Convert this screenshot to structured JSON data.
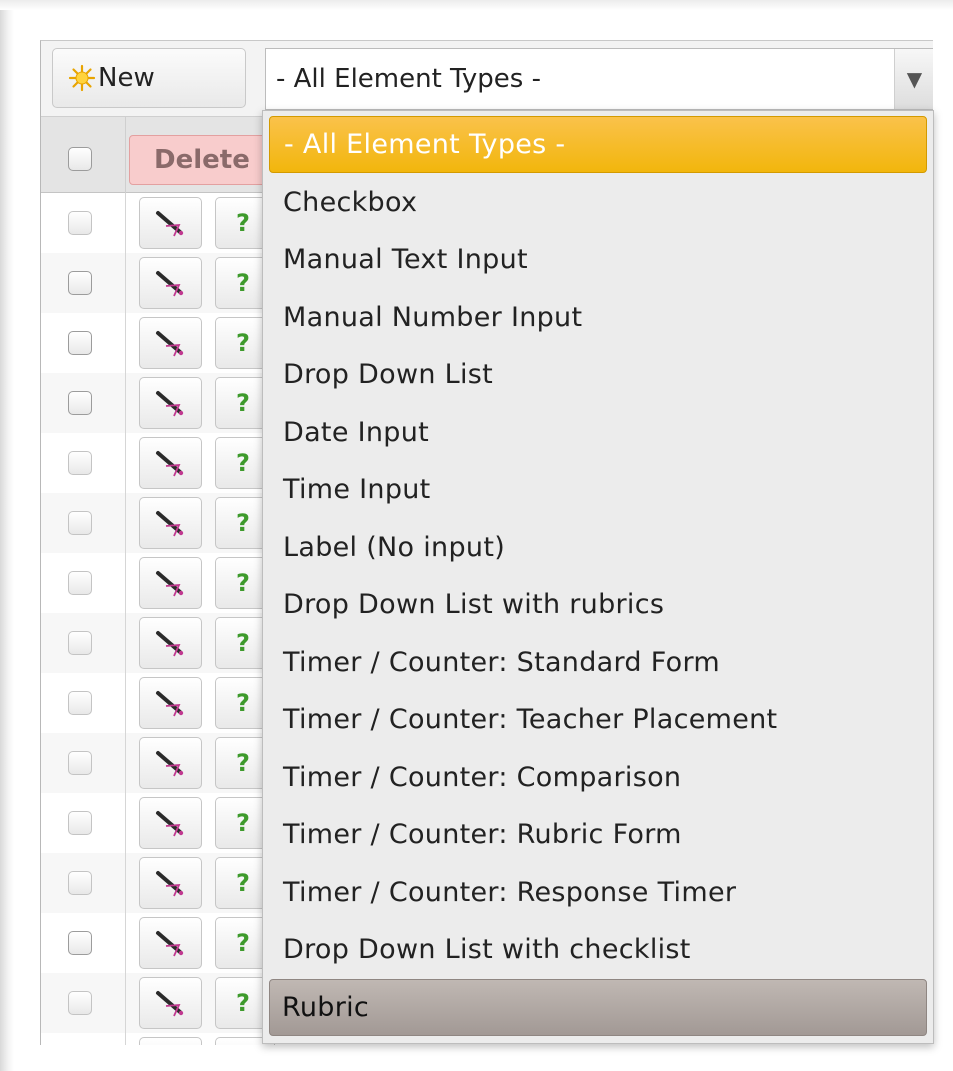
{
  "toolbar": {
    "new_label": "New",
    "filter_value": "- All Element Types -"
  },
  "header": {
    "delete_label": "Delete"
  },
  "grid": {
    "help_glyph": "?",
    "row_count": 15
  },
  "dropdown": {
    "options": [
      "- All Element Types -",
      "Checkbox",
      "Manual Text Input",
      "Manual Number Input",
      "Drop Down List",
      "Date Input",
      "Time Input",
      "Label (No input)",
      "Drop Down List with rubrics",
      "Timer / Counter: Standard Form",
      "Timer / Counter: Teacher Placement",
      "Timer / Counter: Comparison",
      "Timer / Counter: Rubric Form",
      "Timer / Counter: Response Timer",
      "Drop Down List with checklist",
      "Rubric"
    ],
    "selected_index": 0,
    "hover_index": 15
  },
  "colors": {
    "selected_bg": "#f5b91a",
    "hover_bg": "#aaa19d",
    "delete_bg": "#f8cccc",
    "help_green": "#3e9a2c"
  },
  "icons": {
    "new": "new-burst-icon",
    "edit": "edit-pen-icon",
    "dropdown_arrow": "dropdown-arrow-icon"
  }
}
